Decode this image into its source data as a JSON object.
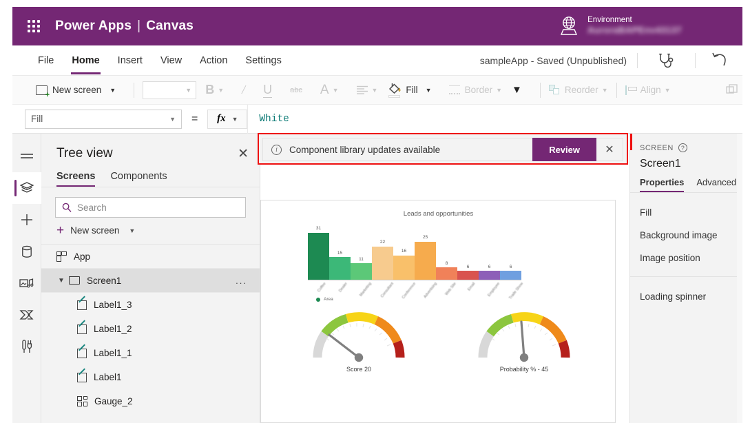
{
  "header": {
    "waffle_icon": "app-launcher-icon",
    "brand": "Power Apps",
    "separator": "|",
    "product": "Canvas",
    "environment_label": "Environment",
    "environment_name": "AuroraBAPEnv43137",
    "environment_icon": "globe-icon",
    "brand_color": "#742774"
  },
  "menubar": {
    "items": [
      {
        "label": "File",
        "active": false
      },
      {
        "label": "Home",
        "active": true
      },
      {
        "label": "Insert",
        "active": false
      },
      {
        "label": "View",
        "active": false
      },
      {
        "label": "Action",
        "active": false
      },
      {
        "label": "Settings",
        "active": false
      }
    ],
    "app_status": "sampleApp - Saved (Unpublished)",
    "checker_icon": "app-checker-stethoscope-icon",
    "undo_icon": "undo-arrow-icon"
  },
  "toolbar": {
    "new_screen": "New screen",
    "font_value": "",
    "bold": "B",
    "italic": "I",
    "underline": "U",
    "strikethrough": "abc",
    "font_color": "A",
    "align": "align-text-icon",
    "fill": "Fill",
    "border": "Border",
    "more_chevron": "chevron-down-icon",
    "reorder": "Reorder",
    "align_objects": "Align",
    "group": "group-icon"
  },
  "formulabar": {
    "property": "Fill",
    "equals": "=",
    "fx": "fx",
    "value": "White"
  },
  "rail": {
    "items": [
      {
        "name": "hamburger-menu-icon",
        "active": false
      },
      {
        "name": "tree-view-layers-icon",
        "active": true
      },
      {
        "name": "insert-plus-icon",
        "active": false
      },
      {
        "name": "data-sources-icon",
        "active": false
      },
      {
        "name": "media-icon",
        "active": false
      },
      {
        "name": "power-automate-icon",
        "active": false
      },
      {
        "name": "variables-tools-icon",
        "active": false
      }
    ]
  },
  "treeview": {
    "title": "Tree view",
    "close_icon": "close-icon",
    "tabs": [
      {
        "label": "Screens",
        "active": true
      },
      {
        "label": "Components",
        "active": false
      }
    ],
    "search_placeholder": "Search",
    "search_value": "",
    "new_screen": "New screen",
    "nodes": [
      {
        "label": "App",
        "icon": "app-icon",
        "indent": false,
        "selected": false
      },
      {
        "label": "Screen1",
        "icon": "screen-icon",
        "indent": false,
        "selected": true,
        "overflow": "..."
      },
      {
        "label": "Label1_3",
        "icon": "label-icon",
        "indent": true,
        "selected": false
      },
      {
        "label": "Label1_2",
        "icon": "label-icon",
        "indent": true,
        "selected": false
      },
      {
        "label": "Label1_1",
        "icon": "label-icon",
        "indent": true,
        "selected": false
      },
      {
        "label": "Label1",
        "icon": "label-icon",
        "indent": true,
        "selected": false
      },
      {
        "label": "Gauge_2",
        "icon": "gauge-icon",
        "indent": true,
        "selected": false
      }
    ]
  },
  "banner": {
    "info_icon": "info-icon",
    "message": "Component library updates available",
    "review_label": "Review",
    "close_icon": "close-icon",
    "highlight_color": "#ee1111"
  },
  "properties_panel": {
    "kind": "SCREEN",
    "help_icon": "help-circle-icon",
    "name": "Screen1",
    "tabs": [
      {
        "label": "Properties",
        "active": true
      },
      {
        "label": "Advanced",
        "active": false
      }
    ],
    "properties": [
      "Fill",
      "Background image",
      "Image position"
    ],
    "extra": [
      "Loading spinner"
    ]
  },
  "chart_data": [
    {
      "type": "bar",
      "title": "Leads and opportunities",
      "categories": [
        "Coffee",
        "Dealer",
        "Marketing",
        "Consultant",
        "Conference",
        "Advertising",
        "Web Site",
        "Email",
        "Employee",
        "Trade Show"
      ],
      "values": [
        31,
        15,
        11,
        22,
        16,
        25,
        8,
        6,
        6,
        6
      ],
      "colors": [
        "#1d8a52",
        "#3cb878",
        "#5cc878",
        "#f7cb8e",
        "#f9c06a",
        "#f6ab4d",
        "#f08159",
        "#d9534f",
        "#8d5fb8",
        "#6f9fe0"
      ],
      "legend": [
        "Area"
      ],
      "legend_position": "bottom-left",
      "xlabel": "",
      "ylabel": "",
      "ylim": [
        0,
        35
      ],
      "grid": false,
      "data_labels": true
    },
    {
      "type": "gauge",
      "title": "Score",
      "caption": "Score    20",
      "value": 20,
      "min": 0,
      "max": 100,
      "bands": [
        {
          "color": "#d8d8d8",
          "to": 10
        },
        {
          "color": "#8cc63e",
          "to": 32
        },
        {
          "color": "#f7d417",
          "to": 58
        },
        {
          "color": "#ef8a1b",
          "to": 85
        },
        {
          "color": "#b5201b",
          "to": 100
        }
      ]
    },
    {
      "type": "gauge",
      "title": "Probability %",
      "caption": "Probability % -  45",
      "value": 45,
      "min": 0,
      "max": 100,
      "bands": [
        {
          "color": "#d8d8d8",
          "to": 10
        },
        {
          "color": "#8cc63e",
          "to": 32
        },
        {
          "color": "#f7d417",
          "to": 58
        },
        {
          "color": "#ef8a1b",
          "to": 85
        },
        {
          "color": "#b5201b",
          "to": 100
        }
      ]
    }
  ]
}
